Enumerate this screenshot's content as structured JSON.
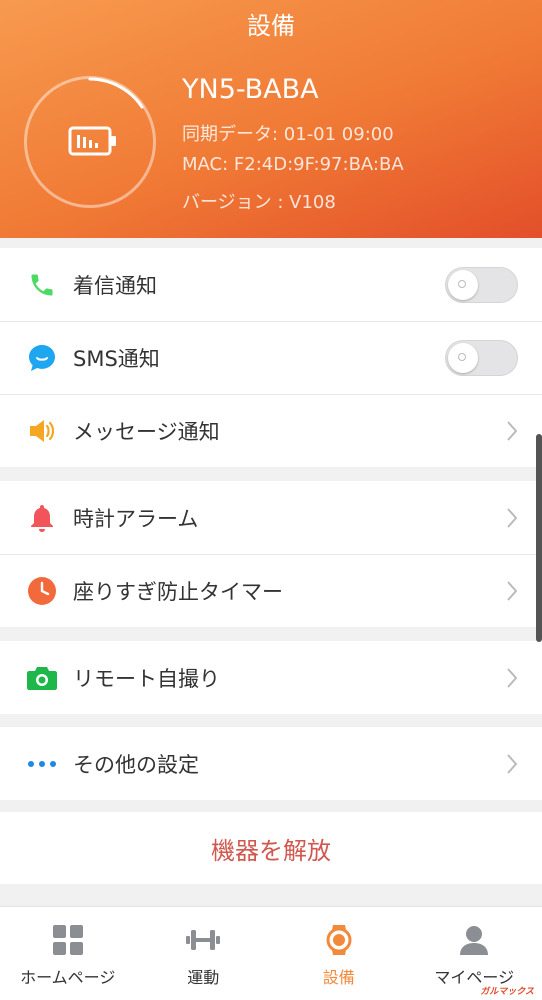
{
  "header": {
    "title": "設備",
    "device_name": "YN5-BABA",
    "sync_text": "同期データ: 01-01 09:00",
    "mac_text": "MAC: F2:4D:9F:97:BA:BA",
    "version_text": "バージョン : V108",
    "battery_icon": "battery-icon"
  },
  "notifications": [
    {
      "icon": "phone-icon",
      "label": "着信通知",
      "control": "toggle",
      "on": false
    },
    {
      "icon": "sms-bubble-icon",
      "label": "SMS通知",
      "control": "toggle",
      "on": false
    },
    {
      "icon": "speaker-icon",
      "label": "メッセージ通知",
      "control": "chevron"
    }
  ],
  "alarms": [
    {
      "icon": "bell-icon",
      "label": "時計アラーム"
    },
    {
      "icon": "clock-icon",
      "label": "座りすぎ防止タイマー"
    }
  ],
  "camera": {
    "icon": "camera-icon",
    "label": "リモート自撮り"
  },
  "other": {
    "icon": "more-dots-icon",
    "label": "その他の設定"
  },
  "release_label": "機器を解放",
  "tabs": [
    {
      "icon": "grid-icon",
      "label": "ホームページ",
      "active": false
    },
    {
      "icon": "dumbbell-icon",
      "label": "運動",
      "active": false
    },
    {
      "icon": "watch-icon",
      "label": "設備",
      "active": true
    },
    {
      "icon": "person-icon",
      "label": "マイページ",
      "active": false
    }
  ],
  "watermark": "ガルマックス",
  "colors": {
    "header_start": "#f79a4f",
    "header_end": "#e34f2a",
    "accent": "#f28a3c",
    "release_text": "#d0584f",
    "phone": "#4cd964",
    "sms": "#1ea7f0",
    "speaker": "#f5a623",
    "bell": "#f2545b",
    "clock": "#f26a3c",
    "camera": "#1eb74a",
    "dots": "#1e88e5"
  }
}
